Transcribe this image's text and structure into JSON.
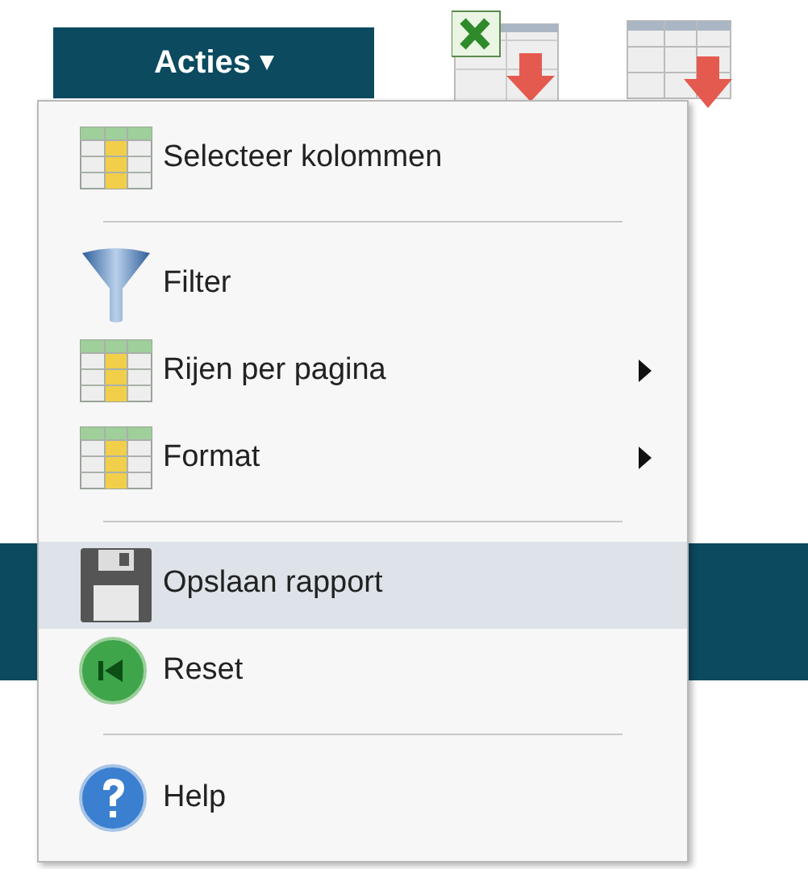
{
  "actions_button": {
    "label": "Acties",
    "caret": "▾"
  },
  "menu": {
    "items": [
      {
        "kind": "item",
        "label": "Selecteer kolommen",
        "has_submenu": false,
        "selected": false
      },
      {
        "kind": "separator"
      },
      {
        "kind": "item",
        "label": "Filter",
        "has_submenu": false,
        "selected": false
      },
      {
        "kind": "item",
        "label": "Rijen per pagina",
        "has_submenu": true,
        "selected": false
      },
      {
        "kind": "item",
        "label": "Format",
        "has_submenu": true,
        "selected": false
      },
      {
        "kind": "separator"
      },
      {
        "kind": "item",
        "label": "Opslaan rapport",
        "has_submenu": false,
        "selected": true
      },
      {
        "kind": "item",
        "label": "Reset",
        "has_submenu": false,
        "selected": false
      },
      {
        "kind": "separator"
      },
      {
        "kind": "item",
        "label": "Help",
        "has_submenu": false,
        "selected": false
      }
    ]
  }
}
